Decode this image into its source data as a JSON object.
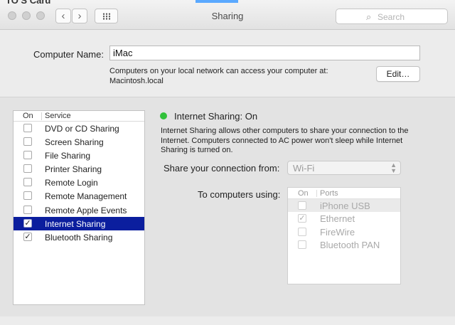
{
  "window": {
    "behind_title": "TO S Card",
    "title": "Sharing",
    "search_placeholder": "Search",
    "back_glyph": "‹",
    "forward_glyph": "›"
  },
  "computer_name": {
    "label": "Computer Name:",
    "value": "iMac",
    "description_line1": "Computers on your local network can access your computer at:",
    "description_line2": "Macintosh.local",
    "edit_label": "Edit…"
  },
  "services": {
    "header_on": "On",
    "header_service": "Service",
    "items": [
      {
        "label": "DVD or CD Sharing",
        "checked": false,
        "selected": false
      },
      {
        "label": "Screen Sharing",
        "checked": false,
        "selected": false
      },
      {
        "label": "File Sharing",
        "checked": false,
        "selected": false
      },
      {
        "label": "Printer Sharing",
        "checked": false,
        "selected": false
      },
      {
        "label": "Remote Login",
        "checked": false,
        "selected": false
      },
      {
        "label": "Remote Management",
        "checked": false,
        "selected": false
      },
      {
        "label": "Remote Apple Events",
        "checked": false,
        "selected": false
      },
      {
        "label": "Internet Sharing",
        "checked": true,
        "selected": true
      },
      {
        "label": "Bluetooth Sharing",
        "checked": true,
        "selected": false
      }
    ]
  },
  "detail": {
    "status_title": "Internet Sharing: On",
    "status_color": "#31c13a",
    "description": "Internet Sharing allows other computers to share your connection to the Internet. Computers connected to AC power won't sleep while Internet Sharing is turned on.",
    "share_from_label": "Share your connection from:",
    "share_from_value": "Wi-Fi",
    "to_computers_label": "To computers using:",
    "ports_header_on": "On",
    "ports_header_ports": "Ports",
    "ports": [
      {
        "label": "iPhone USB",
        "checked": false
      },
      {
        "label": "Ethernet",
        "checked": true
      },
      {
        "label": "FireWire",
        "checked": false
      },
      {
        "label": "Bluetooth PAN",
        "checked": false
      }
    ]
  },
  "colors": {
    "selection": "#0b1e9e",
    "status_green": "#31c13a"
  }
}
